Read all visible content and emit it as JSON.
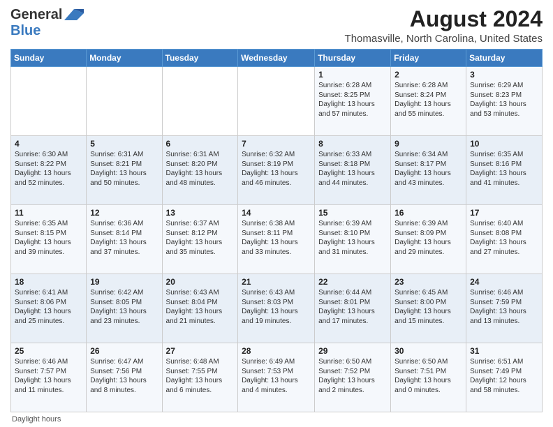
{
  "logo": {
    "general": "General",
    "blue": "Blue"
  },
  "title": "August 2024",
  "subtitle": "Thomasville, North Carolina, United States",
  "days_of_week": [
    "Sunday",
    "Monday",
    "Tuesday",
    "Wednesday",
    "Thursday",
    "Friday",
    "Saturday"
  ],
  "footer": "Daylight hours",
  "weeks": [
    [
      {
        "day": "",
        "sunrise": "",
        "sunset": "",
        "daylight": ""
      },
      {
        "day": "",
        "sunrise": "",
        "sunset": "",
        "daylight": ""
      },
      {
        "day": "",
        "sunrise": "",
        "sunset": "",
        "daylight": ""
      },
      {
        "day": "",
        "sunrise": "",
        "sunset": "",
        "daylight": ""
      },
      {
        "day": "1",
        "sunrise": "Sunrise: 6:28 AM",
        "sunset": "Sunset: 8:25 PM",
        "daylight": "Daylight: 13 hours and 57 minutes."
      },
      {
        "day": "2",
        "sunrise": "Sunrise: 6:28 AM",
        "sunset": "Sunset: 8:24 PM",
        "daylight": "Daylight: 13 hours and 55 minutes."
      },
      {
        "day": "3",
        "sunrise": "Sunrise: 6:29 AM",
        "sunset": "Sunset: 8:23 PM",
        "daylight": "Daylight: 13 hours and 53 minutes."
      }
    ],
    [
      {
        "day": "4",
        "sunrise": "Sunrise: 6:30 AM",
        "sunset": "Sunset: 8:22 PM",
        "daylight": "Daylight: 13 hours and 52 minutes."
      },
      {
        "day": "5",
        "sunrise": "Sunrise: 6:31 AM",
        "sunset": "Sunset: 8:21 PM",
        "daylight": "Daylight: 13 hours and 50 minutes."
      },
      {
        "day": "6",
        "sunrise": "Sunrise: 6:31 AM",
        "sunset": "Sunset: 8:20 PM",
        "daylight": "Daylight: 13 hours and 48 minutes."
      },
      {
        "day": "7",
        "sunrise": "Sunrise: 6:32 AM",
        "sunset": "Sunset: 8:19 PM",
        "daylight": "Daylight: 13 hours and 46 minutes."
      },
      {
        "day": "8",
        "sunrise": "Sunrise: 6:33 AM",
        "sunset": "Sunset: 8:18 PM",
        "daylight": "Daylight: 13 hours and 44 minutes."
      },
      {
        "day": "9",
        "sunrise": "Sunrise: 6:34 AM",
        "sunset": "Sunset: 8:17 PM",
        "daylight": "Daylight: 13 hours and 43 minutes."
      },
      {
        "day": "10",
        "sunrise": "Sunrise: 6:35 AM",
        "sunset": "Sunset: 8:16 PM",
        "daylight": "Daylight: 13 hours and 41 minutes."
      }
    ],
    [
      {
        "day": "11",
        "sunrise": "Sunrise: 6:35 AM",
        "sunset": "Sunset: 8:15 PM",
        "daylight": "Daylight: 13 hours and 39 minutes."
      },
      {
        "day": "12",
        "sunrise": "Sunrise: 6:36 AM",
        "sunset": "Sunset: 8:14 PM",
        "daylight": "Daylight: 13 hours and 37 minutes."
      },
      {
        "day": "13",
        "sunrise": "Sunrise: 6:37 AM",
        "sunset": "Sunset: 8:12 PM",
        "daylight": "Daylight: 13 hours and 35 minutes."
      },
      {
        "day": "14",
        "sunrise": "Sunrise: 6:38 AM",
        "sunset": "Sunset: 8:11 PM",
        "daylight": "Daylight: 13 hours and 33 minutes."
      },
      {
        "day": "15",
        "sunrise": "Sunrise: 6:39 AM",
        "sunset": "Sunset: 8:10 PM",
        "daylight": "Daylight: 13 hours and 31 minutes."
      },
      {
        "day": "16",
        "sunrise": "Sunrise: 6:39 AM",
        "sunset": "Sunset: 8:09 PM",
        "daylight": "Daylight: 13 hours and 29 minutes."
      },
      {
        "day": "17",
        "sunrise": "Sunrise: 6:40 AM",
        "sunset": "Sunset: 8:08 PM",
        "daylight": "Daylight: 13 hours and 27 minutes."
      }
    ],
    [
      {
        "day": "18",
        "sunrise": "Sunrise: 6:41 AM",
        "sunset": "Sunset: 8:06 PM",
        "daylight": "Daylight: 13 hours and 25 minutes."
      },
      {
        "day": "19",
        "sunrise": "Sunrise: 6:42 AM",
        "sunset": "Sunset: 8:05 PM",
        "daylight": "Daylight: 13 hours and 23 minutes."
      },
      {
        "day": "20",
        "sunrise": "Sunrise: 6:43 AM",
        "sunset": "Sunset: 8:04 PM",
        "daylight": "Daylight: 13 hours and 21 minutes."
      },
      {
        "day": "21",
        "sunrise": "Sunrise: 6:43 AM",
        "sunset": "Sunset: 8:03 PM",
        "daylight": "Daylight: 13 hours and 19 minutes."
      },
      {
        "day": "22",
        "sunrise": "Sunrise: 6:44 AM",
        "sunset": "Sunset: 8:01 PM",
        "daylight": "Daylight: 13 hours and 17 minutes."
      },
      {
        "day": "23",
        "sunrise": "Sunrise: 6:45 AM",
        "sunset": "Sunset: 8:00 PM",
        "daylight": "Daylight: 13 hours and 15 minutes."
      },
      {
        "day": "24",
        "sunrise": "Sunrise: 6:46 AM",
        "sunset": "Sunset: 7:59 PM",
        "daylight": "Daylight: 13 hours and 13 minutes."
      }
    ],
    [
      {
        "day": "25",
        "sunrise": "Sunrise: 6:46 AM",
        "sunset": "Sunset: 7:57 PM",
        "daylight": "Daylight: 13 hours and 11 minutes."
      },
      {
        "day": "26",
        "sunrise": "Sunrise: 6:47 AM",
        "sunset": "Sunset: 7:56 PM",
        "daylight": "Daylight: 13 hours and 8 minutes."
      },
      {
        "day": "27",
        "sunrise": "Sunrise: 6:48 AM",
        "sunset": "Sunset: 7:55 PM",
        "daylight": "Daylight: 13 hours and 6 minutes."
      },
      {
        "day": "28",
        "sunrise": "Sunrise: 6:49 AM",
        "sunset": "Sunset: 7:53 PM",
        "daylight": "Daylight: 13 hours and 4 minutes."
      },
      {
        "day": "29",
        "sunrise": "Sunrise: 6:50 AM",
        "sunset": "Sunset: 7:52 PM",
        "daylight": "Daylight: 13 hours and 2 minutes."
      },
      {
        "day": "30",
        "sunrise": "Sunrise: 6:50 AM",
        "sunset": "Sunset: 7:51 PM",
        "daylight": "Daylight: 13 hours and 0 minutes."
      },
      {
        "day": "31",
        "sunrise": "Sunrise: 6:51 AM",
        "sunset": "Sunset: 7:49 PM",
        "daylight": "Daylight: 12 hours and 58 minutes."
      }
    ]
  ]
}
